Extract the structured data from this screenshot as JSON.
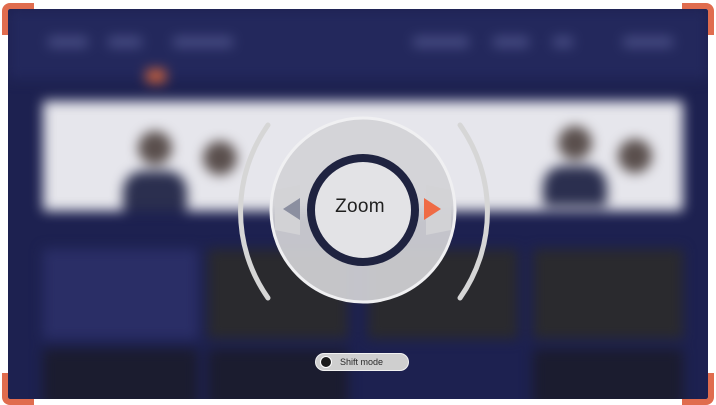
{
  "dial": {
    "label": "Zoom",
    "left_arrow_icon": "left-arrow-icon",
    "right_arrow_icon": "right-arrow-icon",
    "accent_color": "#ef6b45",
    "inactive_arrow_color": "#8b8fa0"
  },
  "shift_mode": {
    "label": "Shift mode",
    "icon": "remote-button-icon"
  },
  "colors": {
    "corner_accent": "#e06c4e",
    "background": "#1d2150"
  }
}
